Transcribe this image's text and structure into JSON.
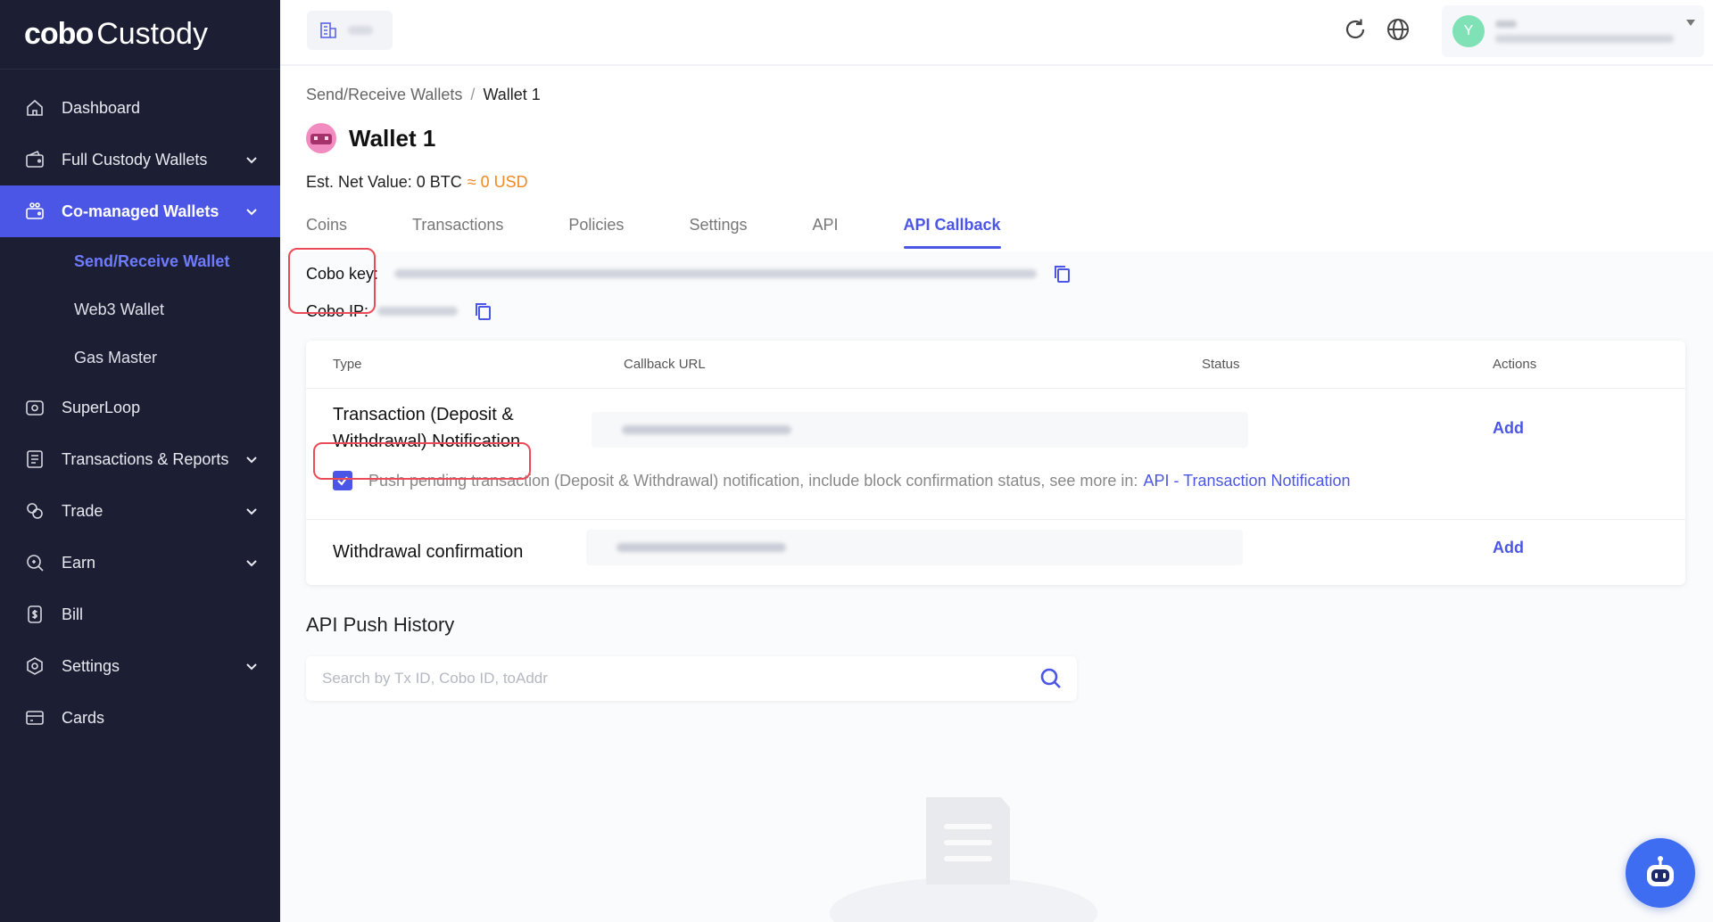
{
  "brand": {
    "mark": "cobo",
    "name": "Custody"
  },
  "sidebar": {
    "items": [
      {
        "label": "Dashboard",
        "icon": "home-icon"
      },
      {
        "label": "Full Custody Wallets",
        "icon": "wallet-icon"
      },
      {
        "label": "Co-managed Wallets",
        "icon": "shared-wallet-icon"
      },
      {
        "label": "SuperLoop",
        "icon": "loop-icon"
      },
      {
        "label": "Transactions & Reports",
        "icon": "report-icon"
      },
      {
        "label": "Trade",
        "icon": "trade-icon"
      },
      {
        "label": "Earn",
        "icon": "earn-icon"
      },
      {
        "label": "Bill",
        "icon": "bill-icon"
      },
      {
        "label": "Settings",
        "icon": "settings-icon"
      },
      {
        "label": "Cards",
        "icon": "card-icon"
      }
    ],
    "sub_items": [
      "Send/Receive Wallet",
      "Web3 Wallet",
      "Gas Master"
    ]
  },
  "topbar": {
    "avatar_letter": "Y"
  },
  "breadcrumb": {
    "parent": "Send/Receive Wallets",
    "separator": "/",
    "current": "Wallet 1"
  },
  "wallet": {
    "name": "Wallet 1",
    "est_label": "Est. Net Value: 0 BTC",
    "est_usd": "≈ 0 USD"
  },
  "tabs": [
    "Coins",
    "Transactions",
    "Policies",
    "Settings",
    "API",
    "API Callback"
  ],
  "keys": {
    "cobo_key_label": "Cobo key:",
    "cobo_ip_label": "Cobo IP:"
  },
  "table": {
    "headers": {
      "type": "Type",
      "url": "Callback URL",
      "status": "Status",
      "actions": "Actions"
    },
    "rows": [
      {
        "type": "Transaction (Deposit & Withdrawal) Notification",
        "action": "Add"
      },
      {
        "type": "Withdrawal confirmation",
        "action": "Add"
      }
    ],
    "push_text": "Push pending transaction (Deposit & Withdrawal) notification, include block confirmation status, see more in:",
    "push_link": "API - Transaction Notification"
  },
  "history": {
    "title": "API Push History",
    "search_placeholder": "Search by Tx ID, Cobo ID, toAddr"
  },
  "colors": {
    "accent": "#4c56e6",
    "sidebar_bg": "#1c1f33",
    "usd": "#f08a24",
    "highlight": "#ea4b57"
  }
}
